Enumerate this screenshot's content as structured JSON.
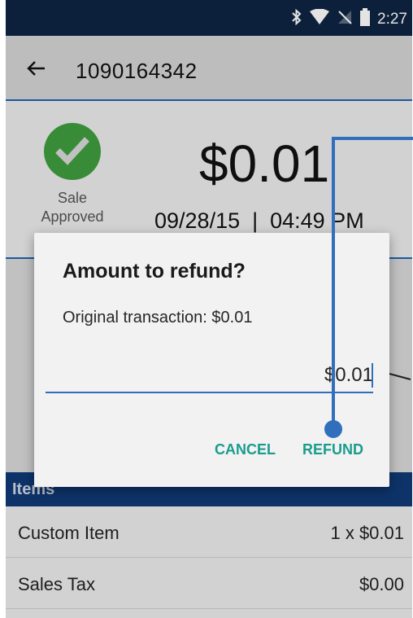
{
  "status_bar": {
    "time": "2:27",
    "icons": [
      "bluetooth-icon",
      "wifi-icon",
      "no-signal-icon",
      "battery-icon"
    ],
    "color": "#0f2543"
  },
  "toolbar": {
    "title": "1090164342",
    "back_icon": "arrow-left-icon"
  },
  "summary": {
    "status_line1": "Sale",
    "status_line2": "Approved",
    "amount": "$0.01",
    "datetime": "09/28/15  |  04:49 PM",
    "status_color": "#3f9e3f"
  },
  "items": {
    "header": "Items",
    "rows": [
      {
        "name": "Custom Item",
        "price": "1 x $0.01"
      },
      {
        "name": "Sales Tax",
        "price": "$0.00"
      }
    ]
  },
  "dialog": {
    "title": "Amount to refund?",
    "message": "Original transaction: $0.01",
    "input_value": "$0.01",
    "cancel_label": "CANCEL",
    "refund_label": "REFUND",
    "button_color": "#1a9c8c"
  },
  "accent_color": "#2f6fbc"
}
